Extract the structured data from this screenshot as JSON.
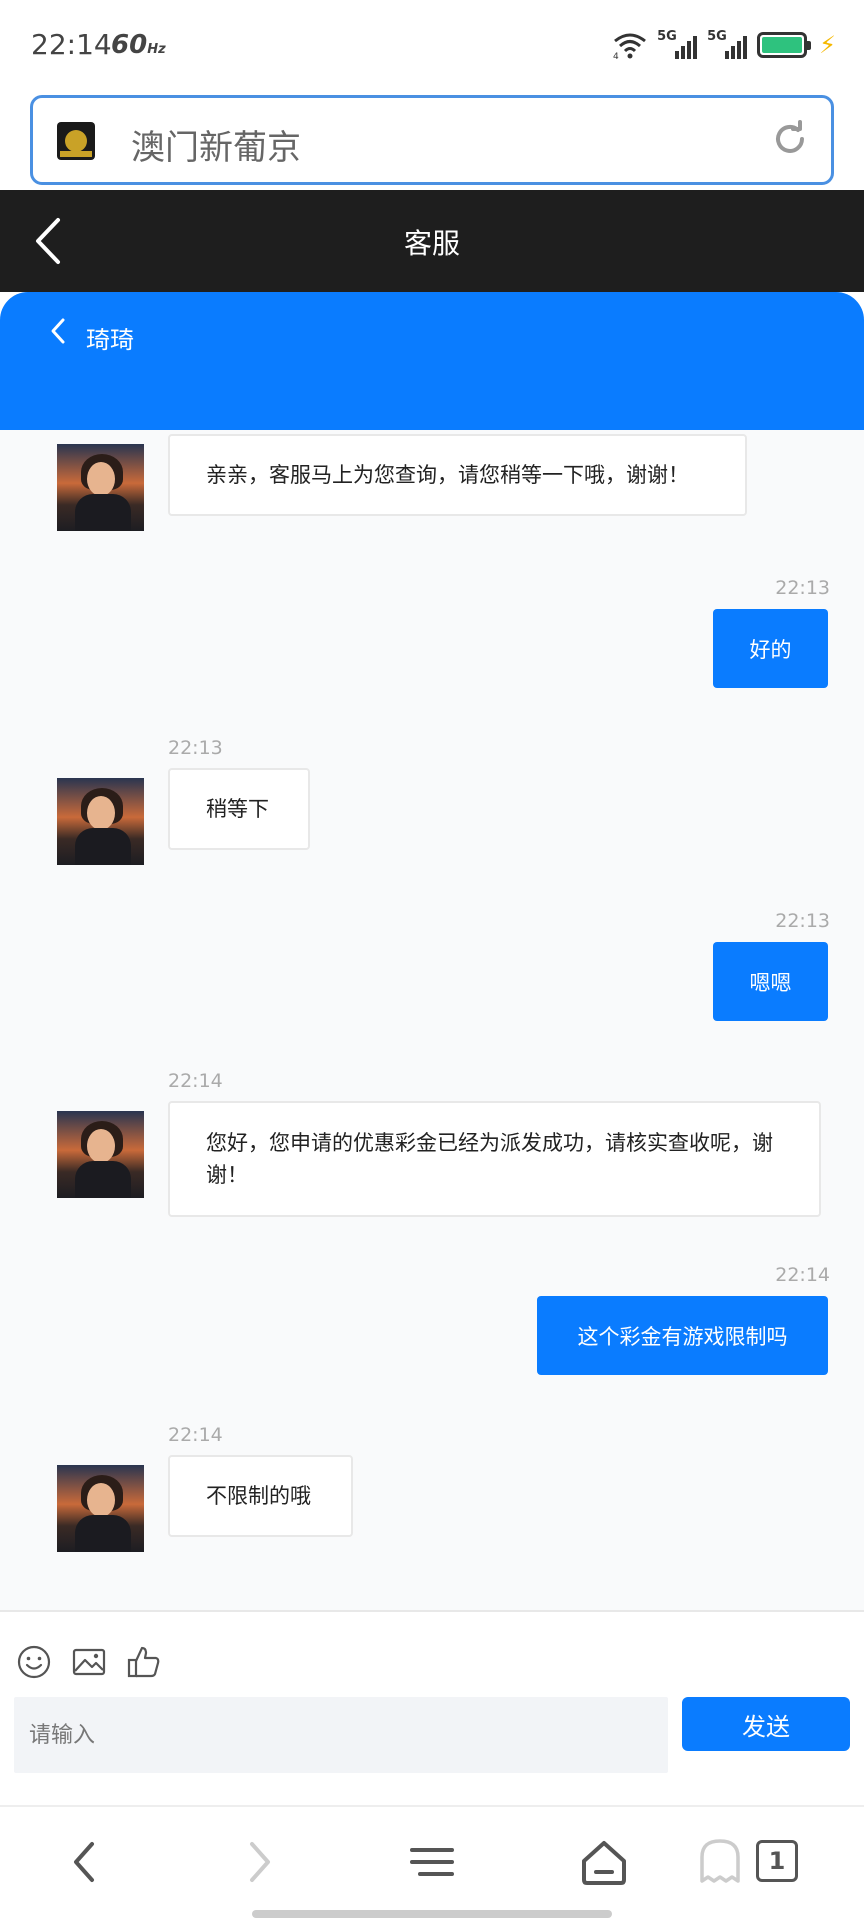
{
  "status_bar": {
    "time": "22:14",
    "refresh_rate": "60",
    "refresh_unit": "Hz",
    "sim1": "5G",
    "sim2": "5G",
    "battery_level": 1.0,
    "wifi_subtag": "4"
  },
  "address_bar": {
    "site_title": "澳门新葡京"
  },
  "header": {
    "title": "客服"
  },
  "chat_header": {
    "agent_name": "琦琦"
  },
  "messages": [
    {
      "from": "agent",
      "text": "亲亲，客服马上为您查询，请您稍等一下哦，谢谢！",
      "time": ""
    },
    {
      "from": "user",
      "text": "好的",
      "time": "22:13"
    },
    {
      "from": "agent",
      "text": "稍等下",
      "time": "22:13"
    },
    {
      "from": "user",
      "text": "嗯嗯",
      "time": "22:13"
    },
    {
      "from": "agent",
      "text": "您好，您申请的优惠彩金已经为派发成功，请核实查收呢，谢谢！",
      "time": "22:14"
    },
    {
      "from": "user",
      "text": "这个彩金有游戏限制吗",
      "time": "22:14"
    },
    {
      "from": "agent",
      "text": "不限制的哦",
      "time": "22:14"
    }
  ],
  "input": {
    "placeholder": "请输入",
    "send_label": "发送"
  },
  "browser_nav": {
    "tab_count": "1"
  },
  "colors": {
    "accent": "#0a7cff",
    "dark_header": "#1e1e1e",
    "address_border": "#4a90e2",
    "battery": "#2ec27e"
  }
}
